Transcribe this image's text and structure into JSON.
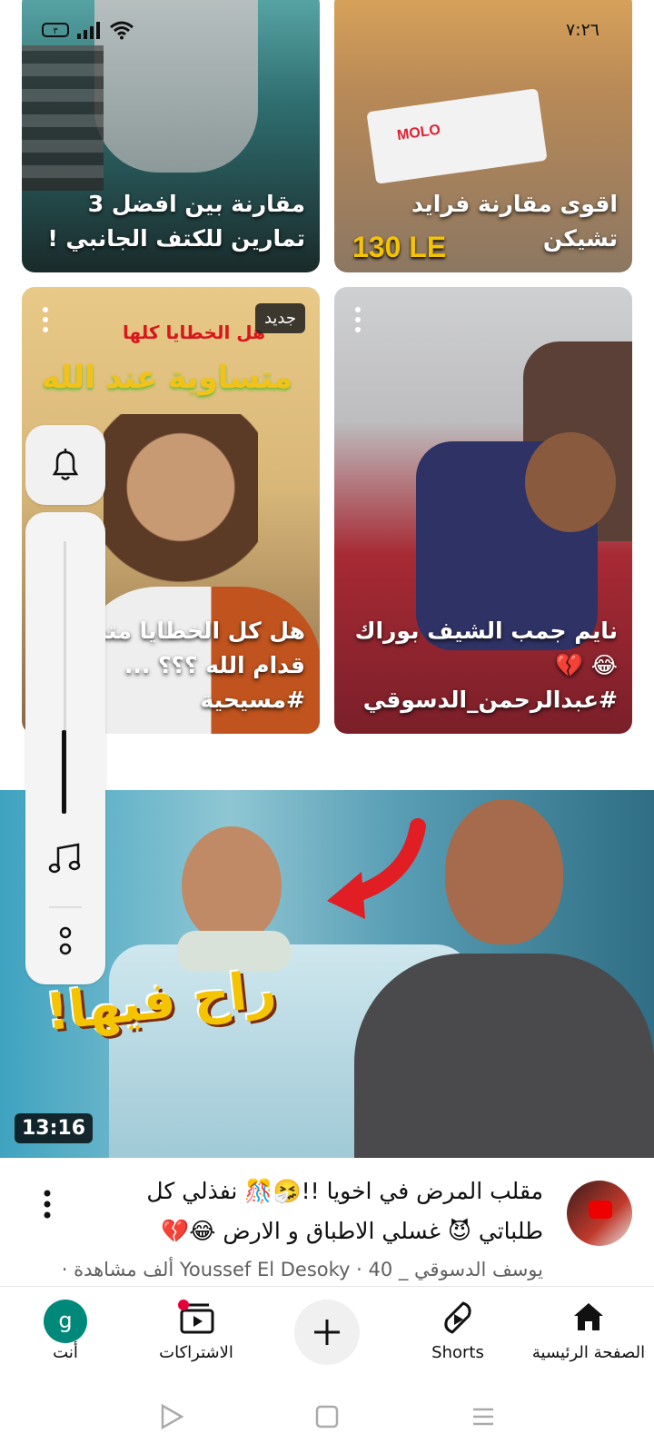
{
  "status_bar": {
    "time": "٧:٢٦",
    "battery": "٣"
  },
  "shorts": [
    {
      "title": "مقارنة بين افضل 3 تمارين للكتف الجانبي  !"
    },
    {
      "title": "اقوى مقارنة فرايد تشيكن",
      "overlay_text": "130 LE",
      "overlay_brand": "MOLO"
    },
    {
      "title": "هل كل الخطايا متساوية قدام الله ؟؟؟ ... #مسيحية",
      "badge": "جديد",
      "thumb_text_1": "هل الخطايا كلها",
      "thumb_text_2": "متساوية عند الله"
    },
    {
      "title": "نايم جمب الشيف بوراك 😂 💔 #عبدالرحمن_الدسوقي"
    }
  ],
  "video": {
    "duration": "13:16",
    "thumb_text": "راح فيها!",
    "title": "مقلب المرض في اخويا !!🤧🎊 نفذلي كل طلباتي 😈 غسلي الاطباق و الارض 😂💔",
    "subtitle": "يوسف الدسوقي _ Youssef El Desoky · 40 ألف مشاهدة ·"
  },
  "side_panel": {
    "icons": [
      "bell-icon",
      "music-note-icon",
      "more-icon"
    ]
  },
  "bottom_nav": {
    "home": "الصفحة الرئيسية",
    "shorts": "Shorts",
    "subscriptions": "الاشتراكات",
    "you": "أنت",
    "you_avatar_letter": "g"
  },
  "colors": {
    "accent_red": "#ff0000",
    "avatar_teal": "#00897b"
  }
}
